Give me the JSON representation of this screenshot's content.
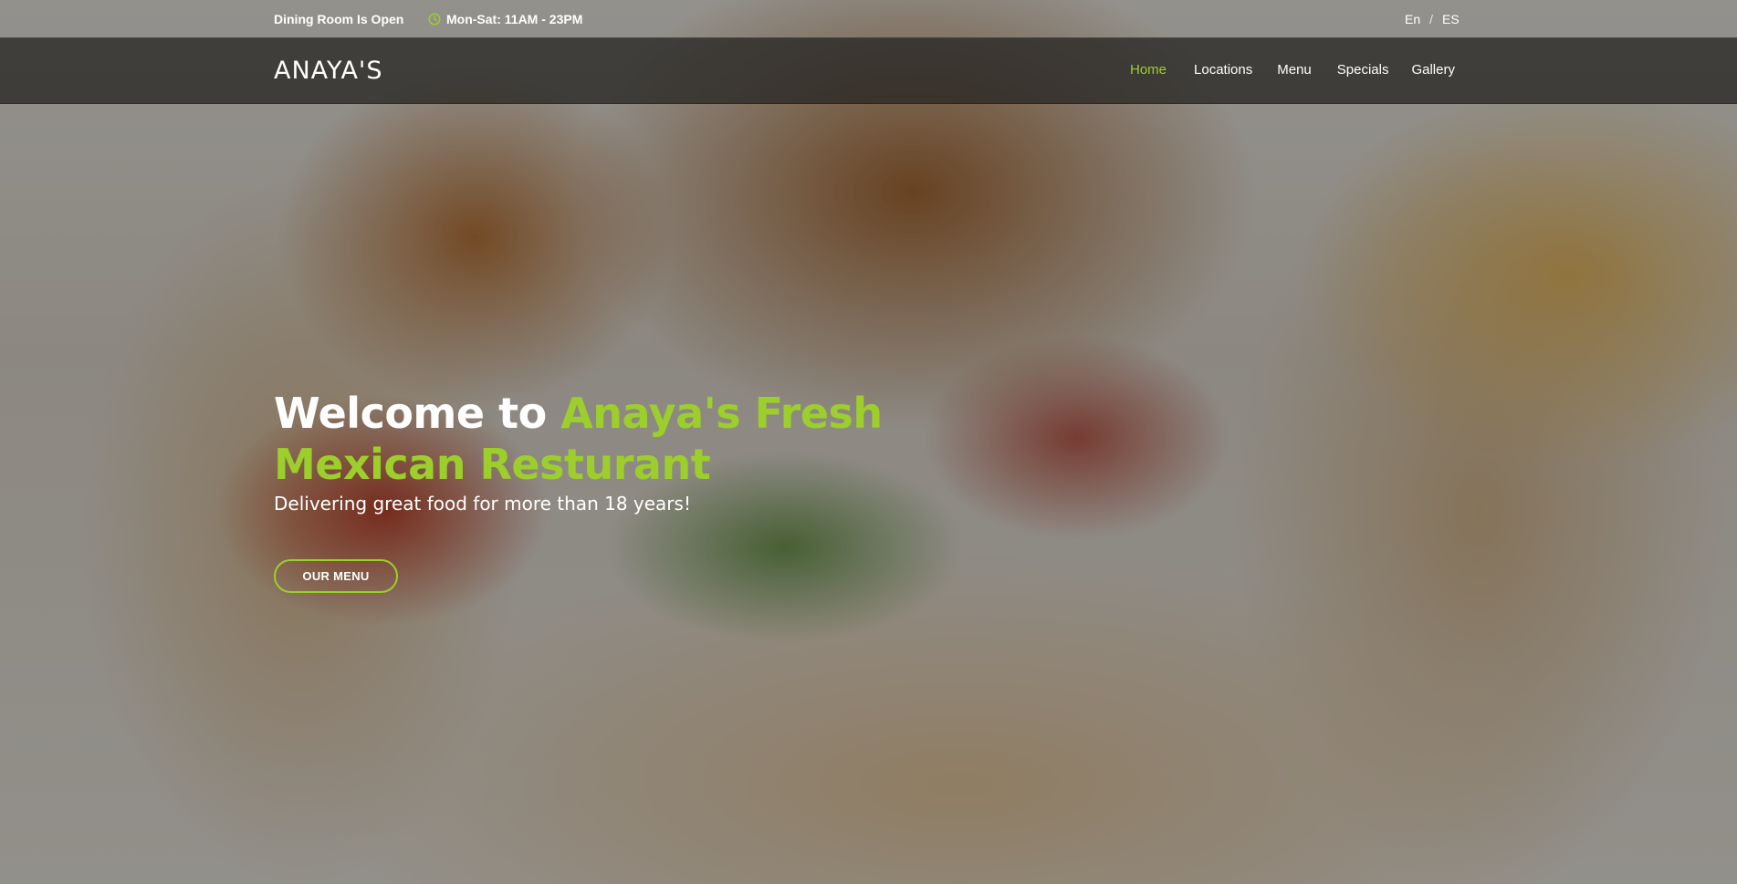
{
  "topbar": {
    "status": "Dining Room Is Open",
    "hours": "Mon-Sat: 11AM - 23PM",
    "hours_icon": "clock-icon",
    "lang_en": "En",
    "lang_separator": "/",
    "lang_es": "ES"
  },
  "navbar": {
    "brand": "ANAYA'S",
    "items": [
      {
        "label": "Home",
        "active": true
      },
      {
        "label": "Locations",
        "active": false
      },
      {
        "label": "Menu",
        "active": false
      },
      {
        "label": "Specials",
        "active": false
      },
      {
        "label": "Gallery",
        "active": false
      }
    ]
  },
  "hero": {
    "title_prefix": "Welcome to ",
    "title_accent": "Anaya's Fresh Mexican Resturant",
    "subtitle": "Delivering great food for more than 18 years!",
    "button_label": "OUR MENU"
  },
  "colors": {
    "accent": "#9ccf2b",
    "nav_background": "#282624",
    "text": "#ffffff"
  }
}
